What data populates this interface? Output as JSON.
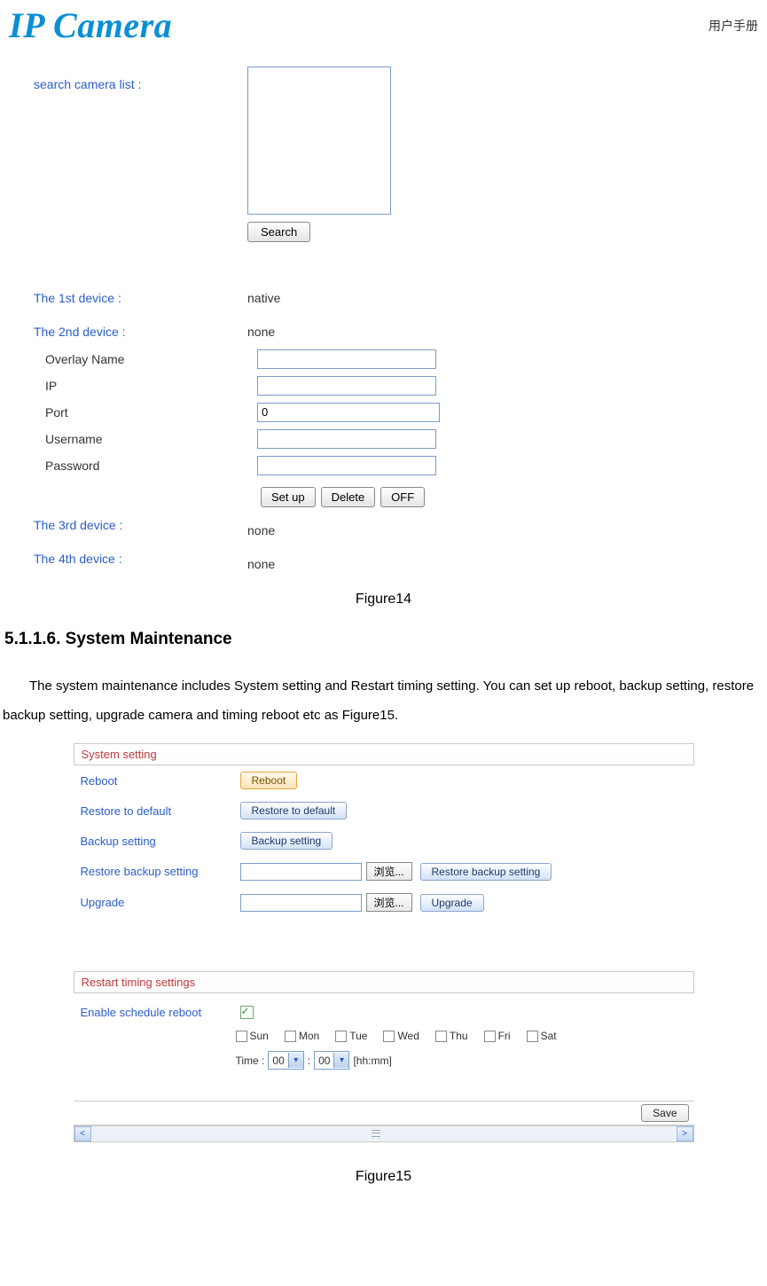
{
  "header": {
    "logo": "IP Camera",
    "right_text": "用户手册"
  },
  "figure14": {
    "search_label": "search camera list :",
    "search_button": "Search",
    "device1_label": "The 1st device :",
    "device1_value": "native",
    "device2_label": "The 2nd device :",
    "device2_value": "none",
    "overlay_label": "Overlay Name",
    "ip_label": "IP",
    "port_label": "Port",
    "port_value": "0",
    "username_label": "Username",
    "password_label": "Password",
    "setup_btn": "Set up",
    "delete_btn": "Delete",
    "off_btn": "OFF",
    "device3_label": "The 3rd device :",
    "device3_value": "none",
    "device4_label": "The 4th device :",
    "device4_value": "none",
    "caption": "Figure14"
  },
  "section": {
    "title": "5.1.1.6. System Maintenance",
    "body": "The system maintenance includes System setting and Restart timing setting. You can set up reboot, backup setting, restore backup setting, upgrade camera and timing reboot etc as Figure15."
  },
  "figure15": {
    "system_setting_header": "System setting",
    "reboot_label": "Reboot",
    "reboot_btn": "Reboot",
    "restore_default_label": "Restore to default",
    "restore_default_btn": "Restore to default",
    "backup_label": "Backup setting",
    "backup_btn": "Backup setting",
    "restore_backup_label": "Restore backup setting",
    "restore_backup_btn": "Restore backup setting",
    "upgrade_label": "Upgrade",
    "upgrade_btn": "Upgrade",
    "browse_btn": "浏览...",
    "restart_header": "Restart timing settings",
    "enable_label": "Enable schedule reboot",
    "days": [
      "Sun",
      "Mon",
      "Tue",
      "Wed",
      "Thu",
      "Fri",
      "Sat"
    ],
    "time_label": "Time :",
    "hour_value": "00",
    "minute_value": "00",
    "time_suffix": "[hh:mm]",
    "save_btn": "Save",
    "caption": "Figure15"
  }
}
